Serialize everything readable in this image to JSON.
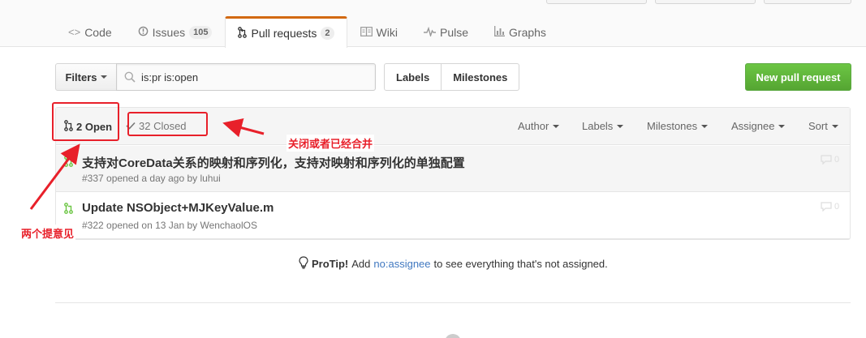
{
  "repo_nav": {
    "tabs": [
      {
        "label": "Code",
        "icon": "code-icon"
      },
      {
        "label": "Issues",
        "count": "105",
        "icon": "issue-icon"
      },
      {
        "label": "Pull requests",
        "count": "2",
        "icon": "pull-request-icon",
        "selected": true
      },
      {
        "label": "Wiki",
        "icon": "book-icon"
      },
      {
        "label": "Pulse",
        "icon": "pulse-icon"
      },
      {
        "label": "Graphs",
        "icon": "graph-icon"
      }
    ]
  },
  "filter_bar": {
    "filters_label": "Filters",
    "search_value": "is:pr is:open",
    "labels_label": "Labels",
    "milestones_label": "Milestones",
    "new_pr_label": "New pull request"
  },
  "table_header": {
    "open_label": "2 Open",
    "closed_label": "32 Closed",
    "filters": [
      "Author",
      "Labels",
      "Milestones",
      "Assignee",
      "Sort"
    ]
  },
  "pull_requests": [
    {
      "title": "支持对CoreData关系的映射和序列化，支持对映射和序列化的单独配置",
      "meta": "#337 opened a day ago by luhui",
      "comments": "0"
    },
    {
      "title": "Update NSObject+MJKeyValue.m",
      "meta": "#322 opened on 13 Jan by WenchaolOS",
      "comments": "0"
    }
  ],
  "protip": {
    "lead": "ProTip!",
    "pre": "Add",
    "link": "no:assignee",
    "post": "to see everything that's not assigned."
  },
  "annotations": {
    "closed_note": "关闭或者已经合并",
    "open_note": "两个提意见"
  },
  "colors": {
    "accent_tab": "#d26911",
    "new_pr_green": "#6cc644",
    "annotation_red": "#e8202a",
    "pr_open_green": "#6cc644",
    "link_blue": "#4078c0"
  }
}
